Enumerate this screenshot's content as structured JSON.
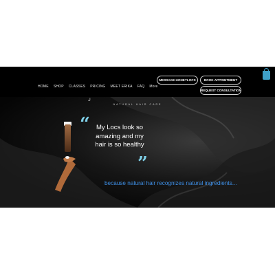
{
  "nav": {
    "items": [
      "HOME",
      "SHOP",
      "CLASSES",
      "PRICING",
      "MEET ERIKA",
      "FAQ",
      "More"
    ]
  },
  "buttons": {
    "message": "MESSAGE HONEYLOCS",
    "book": "BOOK APPOINTMENT",
    "consult": "REQUEST CONSULTATION"
  },
  "cart": {
    "icon": "shopping-bag-icon",
    "color": "#3fa1c9"
  },
  "brand": {
    "tagline": "NATURAL HAIR CARE"
  },
  "hero": {
    "quote": "My Locs look so amazing and my hair is so healthy",
    "subtext": "because natural hair recognizes natural ingredients...",
    "quote_color": "#7fd0e8",
    "subtext_color": "#3e8fe6"
  }
}
